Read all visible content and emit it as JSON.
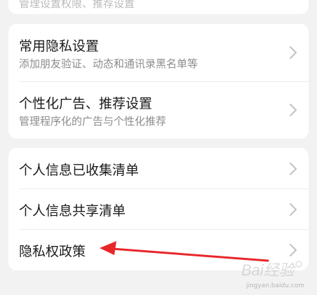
{
  "top_card": {
    "partial_subtitle": "管理设置权限、推荐设置"
  },
  "section_1": {
    "items": [
      {
        "title": "常用隐私设置",
        "subtitle": "添加朋友验证、动态和通讯录黑名单等"
      },
      {
        "title": "个性化广告、推荐设置",
        "subtitle": "管理程序化的广告与个性化推荐"
      }
    ]
  },
  "section_2": {
    "items": [
      {
        "title": "个人信息已收集清单"
      },
      {
        "title": "个人信息共享清单"
      },
      {
        "title": "隐私权政策"
      }
    ]
  },
  "annotation": {
    "arrow_color": "#e8262a"
  },
  "watermark": {
    "logo_text": "Bai经验",
    "url": "jingyan.baidu.com"
  },
  "icons": {
    "chevron": "chevron-right-icon"
  }
}
